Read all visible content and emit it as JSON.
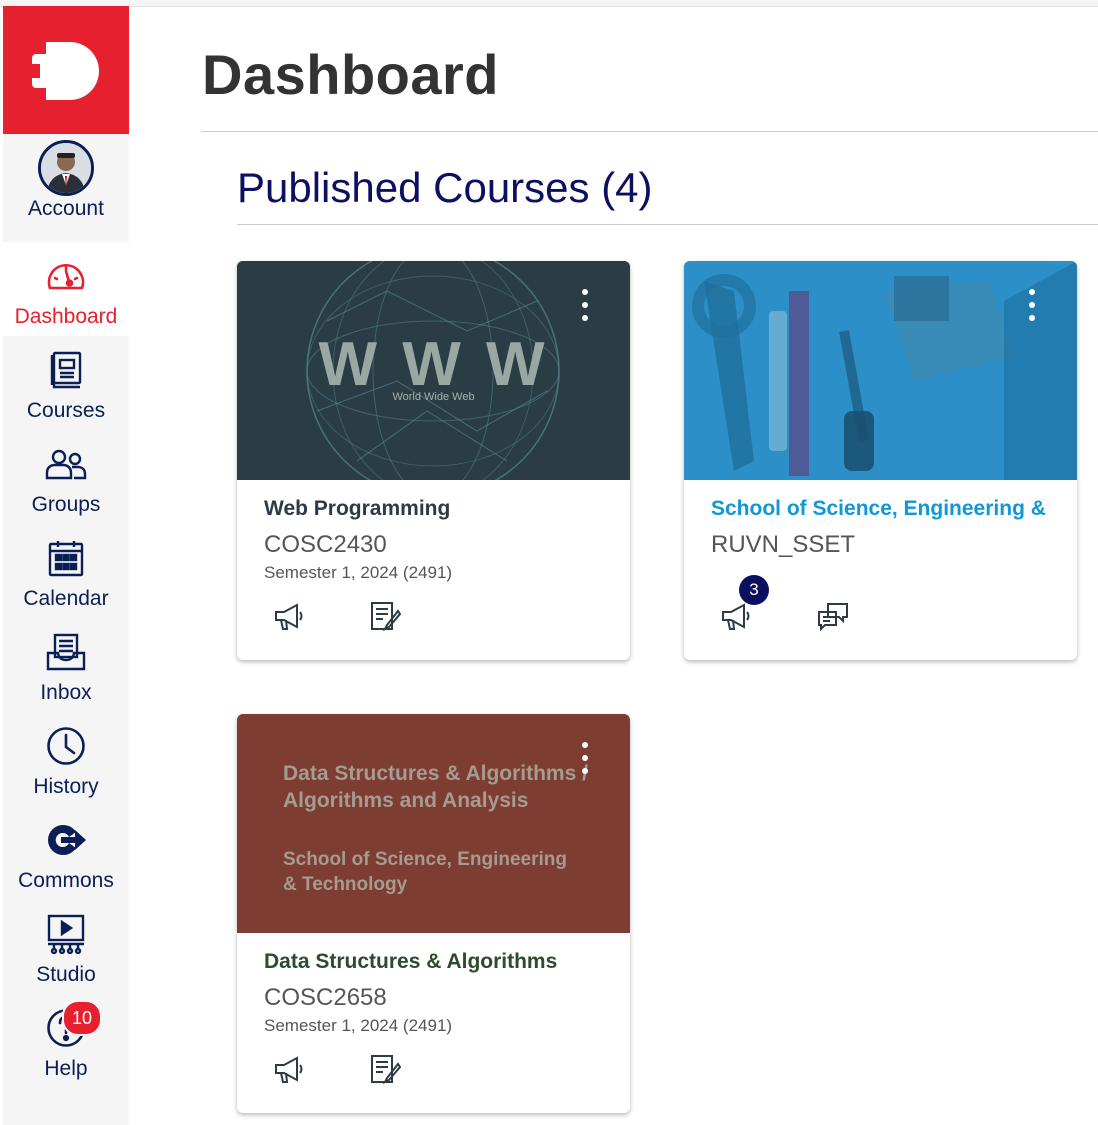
{
  "page": {
    "title": "Dashboard"
  },
  "sidebar": {
    "logo_icon": "brand-logo-icon",
    "items": [
      {
        "label": "Account",
        "icon": "avatar"
      },
      {
        "label": "Dashboard",
        "icon": "dashboard-icon",
        "active": true
      },
      {
        "label": "Courses",
        "icon": "courses-icon"
      },
      {
        "label": "Groups",
        "icon": "groups-icon"
      },
      {
        "label": "Calendar",
        "icon": "calendar-icon"
      },
      {
        "label": "Inbox",
        "icon": "inbox-icon"
      },
      {
        "label": "History",
        "icon": "history-icon"
      },
      {
        "label": "Commons",
        "icon": "commons-icon"
      },
      {
        "label": "Studio",
        "icon": "studio-icon"
      },
      {
        "label": "Help",
        "icon": "help-icon",
        "badge": "10"
      }
    ]
  },
  "section": {
    "title": "Published Courses (4)"
  },
  "courses": [
    {
      "title": "Web Programming",
      "code": "COSC2430",
      "term": "Semester 1, 2024 (2491)",
      "title_color": "#2d3b45",
      "image_text": "W W W",
      "image_subtext": "World Wide Web",
      "icons": [
        "announcements-icon",
        "assignments-icon"
      ]
    },
    {
      "title": "School of Science, Engineering & T...",
      "code": "RUVN_SSET",
      "term": "",
      "title_color": "#0f98d8",
      "announcement_badge": "3",
      "icons": [
        "announcements-icon",
        "discussions-icon"
      ]
    },
    {
      "title": "Data Structures & Algorithms",
      "code": "COSC2658",
      "term": "Semester 1, 2024 (2491)",
      "title_color": "#2d4b2d",
      "image_lines": [
        "Data Structures & Algorithms /",
        "Algorithms and Analysis",
        "School of Science, Engineering",
        "& Technology"
      ],
      "icons": [
        "announcements-icon",
        "assignments-icon"
      ]
    }
  ],
  "colors": {
    "brand": "#e6202e",
    "nav": "#0b1f56",
    "heading": "#0b1160"
  }
}
